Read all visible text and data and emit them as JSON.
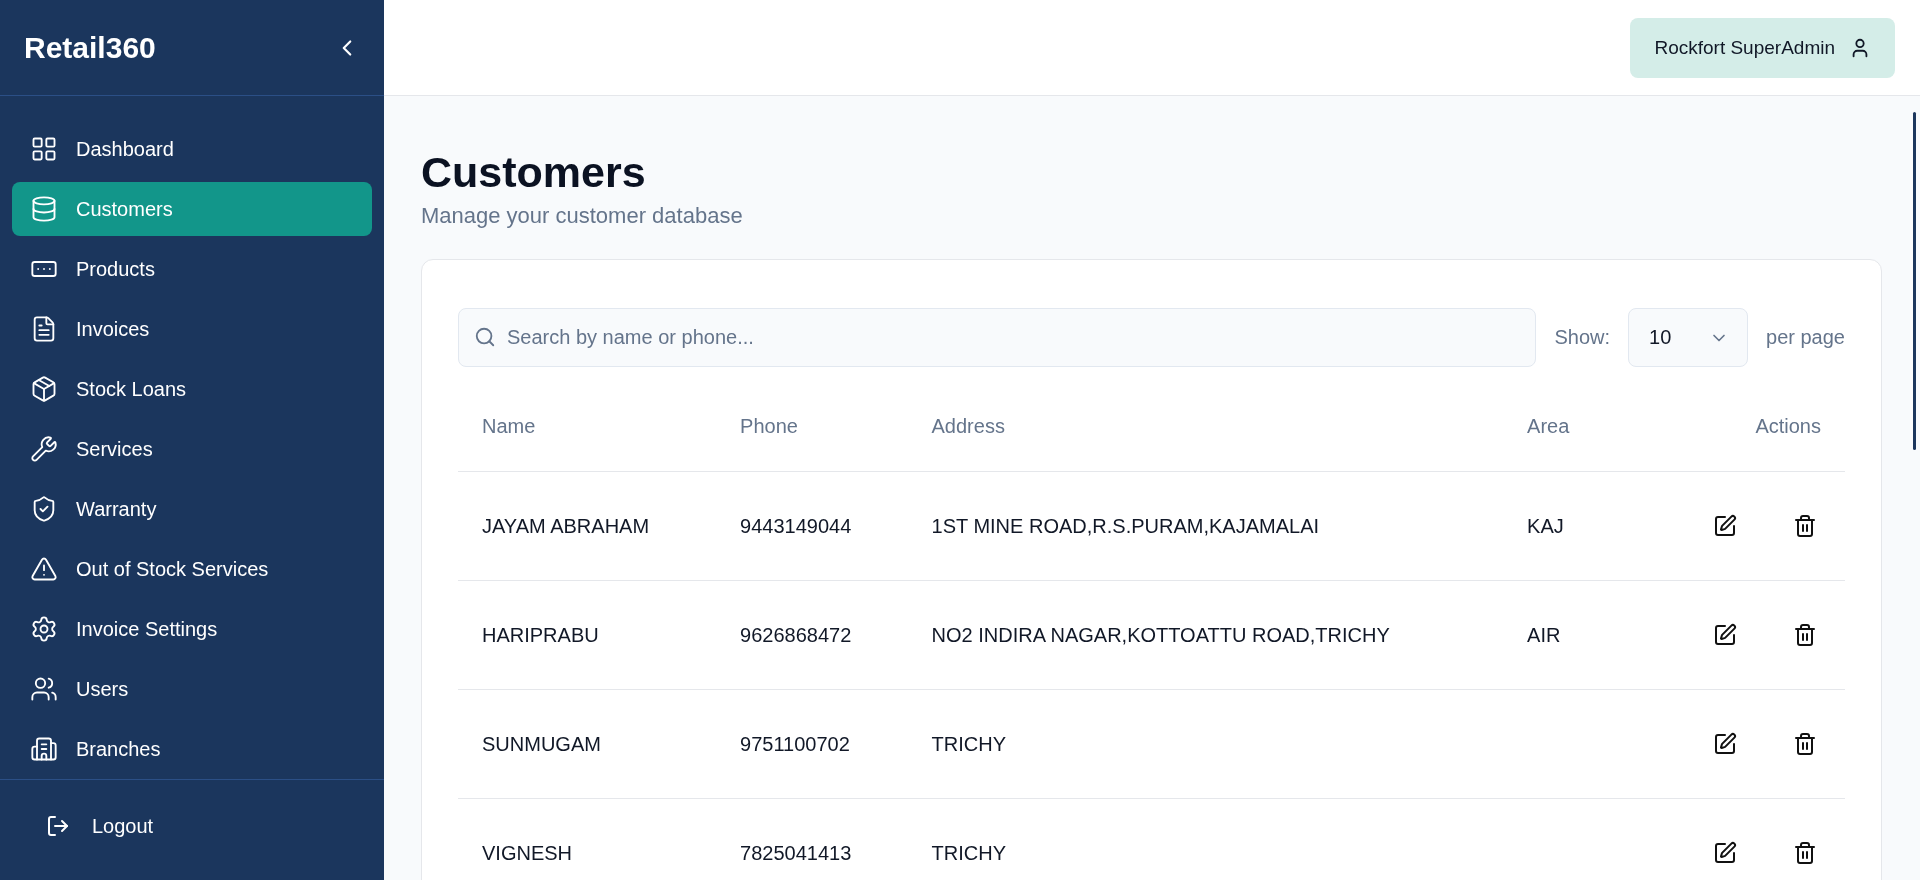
{
  "sidebar": {
    "brand": "Retail360",
    "items": [
      {
        "label": "Dashboard",
        "selected": false
      },
      {
        "label": "Customers",
        "selected": true
      },
      {
        "label": "Products",
        "selected": false
      },
      {
        "label": "Invoices",
        "selected": false
      },
      {
        "label": "Stock Loans",
        "selected": false
      },
      {
        "label": "Services",
        "selected": false
      },
      {
        "label": "Warranty",
        "selected": false
      },
      {
        "label": "Out of Stock Services",
        "selected": false
      },
      {
        "label": "Invoice Settings",
        "selected": false
      },
      {
        "label": "Users",
        "selected": false
      },
      {
        "label": "Branches",
        "selected": false
      }
    ],
    "logout": "Logout"
  },
  "topbar": {
    "user": "Rockfort SuperAdmin"
  },
  "page": {
    "title": "Customers",
    "subtitle": "Manage your customer database"
  },
  "search": {
    "placeholder": "Search by name or phone..."
  },
  "pagination": {
    "show_label": "Show:",
    "per_page": "10",
    "suffix": "per page"
  },
  "table": {
    "columns": [
      "Name",
      "Phone",
      "Address",
      "Area",
      "Actions"
    ],
    "rows": [
      {
        "name": "JAYAM ABRAHAM",
        "phone": "9443149044",
        "address": "1ST MINE ROAD,R.S.PURAM,KAJAMALAI",
        "area": "KAJ"
      },
      {
        "name": "HARIPRABU",
        "phone": "9626868472",
        "address": "NO2 INDIRA NAGAR,KOTTOATTU ROAD,TRICHY",
        "area": "AIR"
      },
      {
        "name": "SUNMUGAM",
        "phone": "9751100702",
        "address": "TRICHY",
        "area": ""
      },
      {
        "name": "VIGNESH",
        "phone": "7825041413",
        "address": "TRICHY",
        "area": ""
      }
    ]
  }
}
